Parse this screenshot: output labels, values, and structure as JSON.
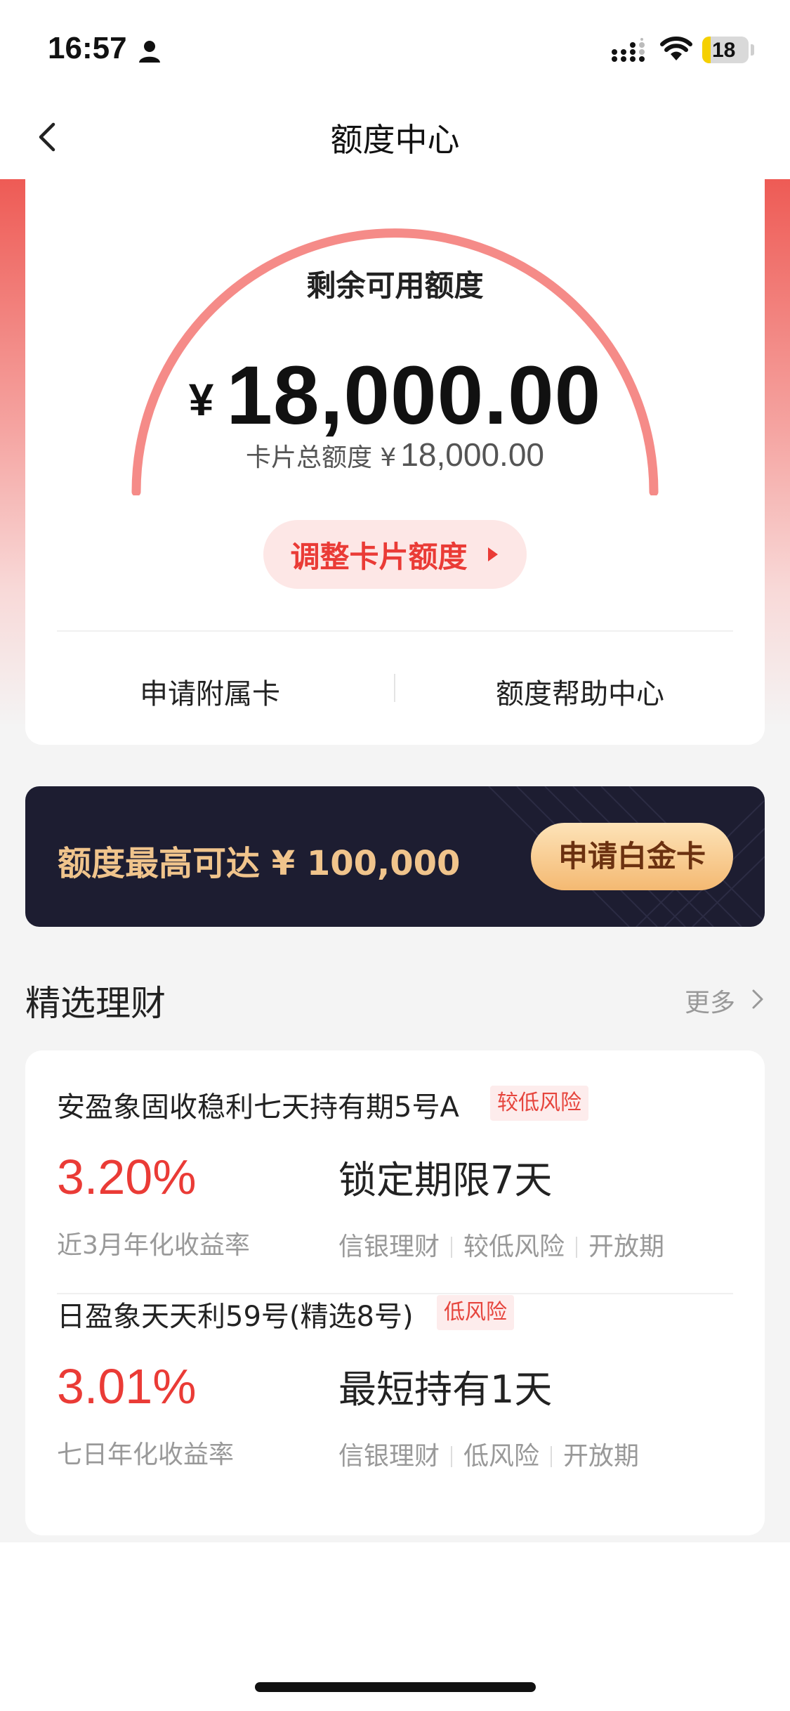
{
  "status_bar": {
    "time": "16:57",
    "battery_level": "18"
  },
  "nav": {
    "title": "额度中心"
  },
  "quota": {
    "remaining_label": "剩余可用额度",
    "currency_symbol": "¥",
    "remaining_amount": "18,000.00",
    "total_label": "卡片总额度 ¥",
    "total_amount": "18,000.00",
    "adjust_button_label": "调整卡片额度",
    "links": {
      "supplementary_card": "申请附属卡",
      "help_center": "额度帮助中心"
    }
  },
  "promo": {
    "text": "额度最高可达 ¥ 100,000",
    "button_label": "申请白金卡"
  },
  "wealth": {
    "section_title": "精选理财",
    "more_label": "更多",
    "products": [
      {
        "name": "安盈象固收稳利七天持有期5号A",
        "risk_badge": "较低风险",
        "rate": "3.20%",
        "rate_label": "近3月年化收益率",
        "term": "锁定期限7天",
        "tags": [
          "信银理财",
          "较低风险",
          "开放期"
        ]
      },
      {
        "name": "日盈象天天利59号(精选8号)",
        "risk_badge": "低风险",
        "rate": "3.01%",
        "rate_label": "七日年化收益率",
        "term": "最短持有1天",
        "tags": [
          "信银理财",
          "低风险",
          "开放期"
        ]
      }
    ]
  },
  "colors": {
    "accent_red": "#ea3b36",
    "gold": "#f0c48c",
    "banner_dark": "#1d1d31"
  }
}
